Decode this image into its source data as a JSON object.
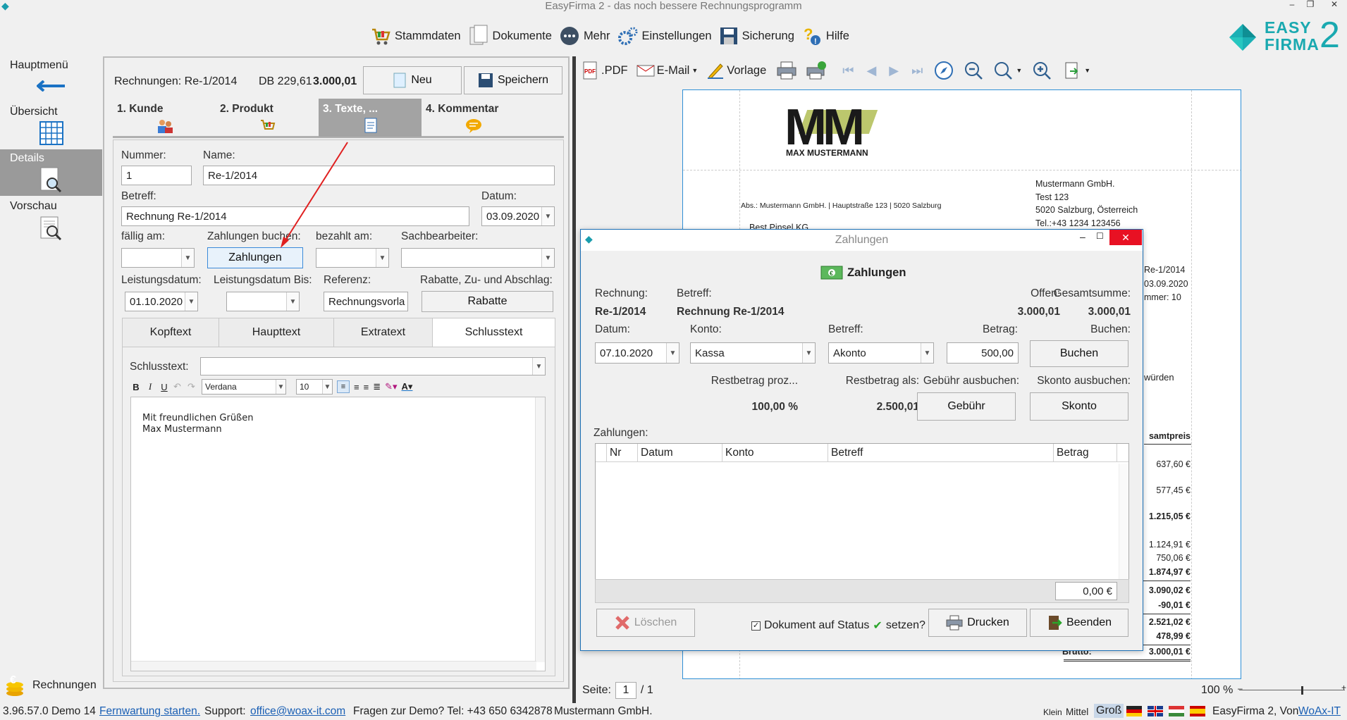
{
  "app": {
    "title": "EasyFirma 2 - das noch bessere Rechnungsprogramm"
  },
  "menu": {
    "stammdaten": "Stammdaten",
    "dokumente": "Dokumente",
    "mehr": "Mehr",
    "einstellungen": "Einstellungen",
    "sicherung": "Sicherung",
    "hilfe": "Hilfe"
  },
  "logo": {
    "line1": "EASY",
    "line2": "FIRMA",
    "num": "2"
  },
  "sidebar": {
    "hauptmenu": "Hauptmenü",
    "ubersicht": "Übersicht",
    "details": "Details",
    "vorschau": "Vorschau",
    "rechnungen": "Rechnungen"
  },
  "header": {
    "rechnung": "Rechnungen: Re-1/2014",
    "db": "DB 229,61",
    "sum": "3.000,01",
    "neu": "Neu",
    "speichern": "Speichern"
  },
  "steps": [
    "1. Kunde",
    "2. Produkt",
    "3. Texte, ...",
    "4. Kommentar"
  ],
  "form": {
    "nummer_lbl": "Nummer:",
    "nummer": "1",
    "name_lbl": "Name:",
    "name": "Re-1/2014",
    "betreff_lbl": "Betreff:",
    "betreff": "Rechnung Re-1/2014",
    "datum_lbl": "Datum:",
    "datum": "03.09.2020",
    "faellig_lbl": "fällig am:",
    "zahlungen_lbl": "Zahlungen buchen:",
    "zahlungen_btn": "Zahlungen",
    "bezahlt_lbl": "bezahlt am:",
    "sachb_lbl": "Sachbearbeiter:",
    "leist_lbl": "Leistungsdatum:",
    "leist": "01.10.2020",
    "leistbis_lbl": "Leistungsdatum Bis:",
    "ref_lbl": "Referenz:",
    "ref": "Rechnungsvorla",
    "rabatt_lbl": "Rabatte, Zu- und Abschlag:",
    "rabatt_btn": "Rabatte"
  },
  "texttabs": [
    "Kopftext",
    "Haupttext",
    "Extratext",
    "Schlusstext"
  ],
  "editor": {
    "label": "Schlusstext:",
    "font": "Verdana",
    "size": "10",
    "line1": "Mit freundlichen Grüßen",
    "line2": "Max Mustermann"
  },
  "preview_toolbar": {
    "pdf": ".PDF",
    "email": "E-Mail",
    "vorlage": "Vorlage"
  },
  "preview": {
    "brand": "MAX MUSTERMANN",
    "sender": "Abs.: Mustermann GmbH. | Hauptstraße 123 | 5020 Salzburg",
    "company": [
      "Mustermann GmbH.",
      "Test 123",
      "5020 Salzburg, Österreich",
      "Tel.:+43 1234 123456"
    ],
    "recipient": "Best Pinsel KG",
    "meta": [
      "Re-1/2014",
      "03.09.2020",
      "mmer: 10"
    ],
    "wurden": "würden",
    "col_head": "samtpreis",
    "amounts": [
      "637,60 €",
      "577,45 €",
      "1.215,05 €",
      "1.124,91 €",
      "750,06 €",
      "1.874,97 €",
      "3.090,02 €",
      "-90,01 €",
      "2.521,02 €",
      "478,99 €",
      "3.000,01 €"
    ],
    "brutto": "Brutto:"
  },
  "page": {
    "seite": "Seite:",
    "current": "1",
    "total": "/ 1",
    "zoom": "100 %"
  },
  "dialog": {
    "title": "Zahlungen",
    "heading": "Zahlungen",
    "rechnung_lbl": "Rechnung:",
    "rechnung": "Re-1/2014",
    "betreff_lbl": "Betreff:",
    "betreff": "Rechnung Re-1/2014",
    "offen_lbl": "Offen:",
    "offen": "3.000,01",
    "gesamt_lbl": "Gesamtsumme:",
    "gesamt": "3.000,01",
    "datum_lbl": "Datum:",
    "datum": "07.10.2020",
    "konto_lbl": "Konto:",
    "konto": "Kassa",
    "betreff2_lbl": "Betreff:",
    "betreff2": "Akonto",
    "betrag_lbl": "Betrag:",
    "betrag": "500,00",
    "buchen_lbl": "Buchen:",
    "buchen_btn": "Buchen",
    "rest_proz_lbl": "Restbetrag proz...",
    "rest_proz": "100,00 %",
    "rest_als_lbl": "Restbetrag als:",
    "rest_als": "2.500,01",
    "gebuehr_lbl": "Gebühr ausbuchen:",
    "gebuehr_btn": "Gebühr",
    "skonto_lbl": "Skonto ausbuchen:",
    "skonto_btn": "Skonto",
    "zahlungen_lbl": "Zahlungen:",
    "cols": [
      "Nr",
      "Datum",
      "Konto",
      "Betreff",
      "Betrag"
    ],
    "total": "0,00 €",
    "loeschen": "Löschen",
    "status_a": "Dokument auf Status",
    "status_b": "setzen?",
    "drucken": "Drucken",
    "beenden": "Beenden"
  },
  "status": {
    "version": "3.96.57.0 Demo 14",
    "fern": "Fernwartung starten.",
    "support": "Support:",
    "email": "office@woax-it.com",
    "demo": "Fragen zur Demo? Tel: +43 650 6342878",
    "company": "Mustermann GmbH.",
    "klein": "Klein",
    "mittel": "Mittel",
    "gross": "Groß",
    "brand": "EasyFirma 2, Von",
    "woax": "WoAx-IT"
  },
  "colors": {
    "accent": "#1a9dad",
    "arrow": "#e02020",
    "sidebar_sel": "#9a9a9a"
  }
}
